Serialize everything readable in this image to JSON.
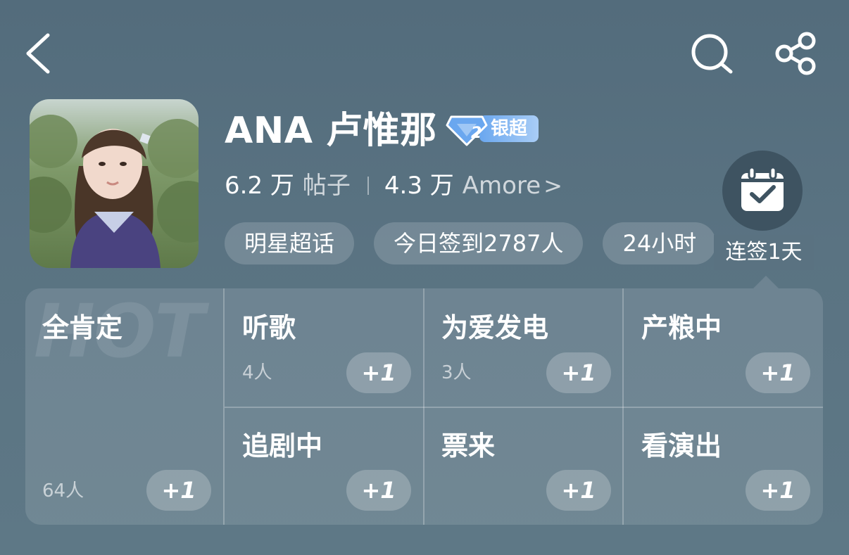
{
  "topbar": {
    "back_icon": "chevron-left-icon",
    "search_icon": "search-icon",
    "share_icon": "share-icon"
  },
  "profile": {
    "name": "ANA 卢惟那",
    "rank_label": "银超",
    "rank_level": "2",
    "posts_count": "6.2 万",
    "posts_label": "帖子",
    "fans_count": "4.3 万",
    "fans_label": "Amore",
    "fans_chevron": ">"
  },
  "tags": [
    {
      "label": "明星超话"
    },
    {
      "label": "今日签到2787人"
    },
    {
      "label": "24小时"
    }
  ],
  "checkin": {
    "icon": "calendar-check-icon",
    "label": "连签1天"
  },
  "grid": {
    "watermark": "HOT",
    "cells": [
      {
        "name": "全肯定",
        "count": "64人",
        "action": "+1"
      },
      {
        "name": "听歌",
        "count": "4人",
        "action": "+1"
      },
      {
        "name": "为爱发电",
        "count": "3人",
        "action": "+1"
      },
      {
        "name": "产粮中",
        "count": "",
        "action": "+1"
      },
      {
        "name": "追剧中",
        "count": "",
        "action": "+1"
      },
      {
        "name": "票来",
        "count": "",
        "action": "+1"
      },
      {
        "name": "看演出",
        "count": "",
        "action": "+1"
      }
    ]
  },
  "colors": {
    "background": "#5a7382",
    "checkin_bg": "#3e5361",
    "rank_badge": "#6aa7ef"
  }
}
